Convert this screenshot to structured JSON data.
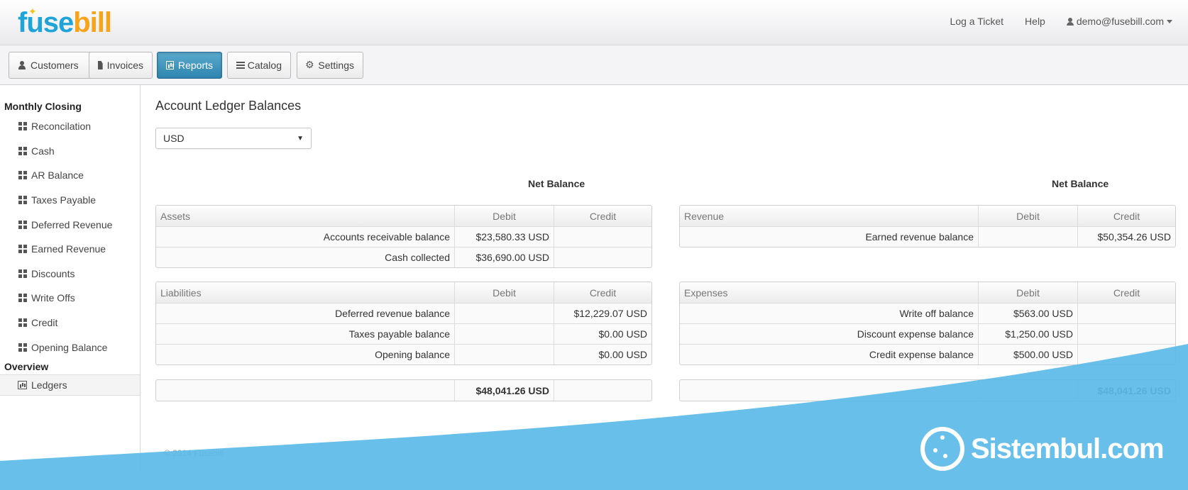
{
  "header": {
    "logo": {
      "part1": "fuse",
      "part2": "bill"
    },
    "links": {
      "ticket": "Log a Ticket",
      "help": "Help",
      "user": "demo@fusebill.com"
    }
  },
  "nav": {
    "customers": "Customers",
    "invoices": "Invoices",
    "reports": "Reports",
    "catalog": "Catalog",
    "settings": "Settings"
  },
  "sidebar": {
    "section1": "Monthly Closing",
    "items": [
      "Reconcilation",
      "Cash",
      "AR Balance",
      "Taxes Payable",
      "Deferred Revenue",
      "Earned Revenue",
      "Discounts",
      "Write Offs",
      "Credit",
      "Opening Balance"
    ],
    "section2": "Overview",
    "overview_item": "Ledgers"
  },
  "main": {
    "title": "Account Ledger Balances",
    "currency": "USD",
    "net_balance_label": "Net Balance",
    "col_debit": "Debit",
    "col_credit": "Credit",
    "assets": {
      "header": "Assets",
      "rows": [
        {
          "label": "Accounts receivable balance",
          "debit": "$23,580.33 USD",
          "credit": ""
        },
        {
          "label": "Cash collected",
          "debit": "$36,690.00 USD",
          "credit": ""
        }
      ]
    },
    "liabilities": {
      "header": "Liabilities",
      "rows": [
        {
          "label": "Deferred revenue balance",
          "debit": "",
          "credit": "$12,229.07 USD"
        },
        {
          "label": "Taxes payable balance",
          "debit": "",
          "credit": "$0.00 USD"
        },
        {
          "label": "Opening balance",
          "debit": "",
          "credit": "$0.00 USD"
        }
      ]
    },
    "revenue": {
      "header": "Revenue",
      "rows": [
        {
          "label": "Earned revenue balance",
          "debit": "",
          "credit": "$50,354.26 USD"
        }
      ]
    },
    "expenses": {
      "header": "Expenses",
      "rows": [
        {
          "label": "Write off balance",
          "debit": "$563.00 USD",
          "credit": ""
        },
        {
          "label": "Discount expense balance",
          "debit": "$1,250.00 USD",
          "credit": ""
        },
        {
          "label": "Credit expense balance",
          "debit": "$500.00 USD",
          "credit": ""
        }
      ]
    },
    "left_total": "$48,041.26 USD",
    "right_total": "$48,041.26 USD"
  },
  "footer": "© 2014 Fusebill",
  "watermark": "Sistembul.com",
  "colors": {
    "accent": "#2f86b0",
    "watermark_blue": "#5bbbe8"
  }
}
